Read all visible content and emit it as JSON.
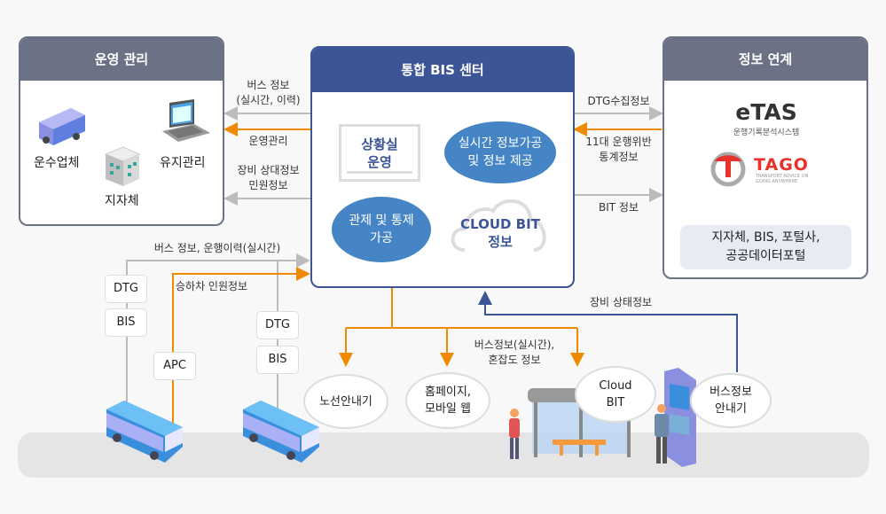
{
  "colors": {
    "panel_header": "#6b7285",
    "center_header": "#3c5597",
    "ellipse_fill": "#4585c5",
    "arrow_gray": "#bbbbbb",
    "arrow_orange": "#f08a00",
    "arrow_navy": "#3c5597",
    "road": "#e5e5e5"
  },
  "operations_panel": {
    "title": "운영 관리",
    "items": [
      {
        "label": "운수업체",
        "icon": "bus-icon"
      },
      {
        "label": "지자체",
        "icon": "building-icon"
      },
      {
        "label": "유지관리",
        "icon": "laptop-icon"
      }
    ]
  },
  "center_panel": {
    "title": "통합 BIS 센터",
    "situation_room": "상황실\n운영",
    "realtime_processing": "실시간 정보가공\n및 정보 제공",
    "control_processing": "관제 및 통제\n가공",
    "cloud_bit": "CLOUD BIT\n정보"
  },
  "partner_panel": {
    "title": "정보 연계",
    "etas_logo": "eTAS",
    "etas_sub": "운행기록분석시스템",
    "tago_logo": "TAGO",
    "tago_sub": "TRANSPORT ADVICE ON\nGOING ANYWHERE",
    "partners": "지자체, BIS, 포털사,\n공공데이터포털"
  },
  "flows": {
    "bus_info_history": "버스 정보\n(실시간, 이력)",
    "operation_mgmt": "운영관리",
    "equipment_complaint": "장비 상대정보\n민원정보",
    "dtg_collect": "DTG수집정보",
    "violation_stats": "11대 운행위반\n통계정보",
    "bit_info": "BIT 정보",
    "bus_history_realtime": "버스 정보, 운행이력(실시간)",
    "boarding_count": "승하차 인원정보",
    "equipment_status": "장비 상태정보",
    "bus_info_congestion": "버스정보(실시간),\n혼잡도 정보"
  },
  "devices": {
    "bus1": [
      "DTG",
      "BIS"
    ],
    "apc": "APC",
    "bus2": [
      "DTG",
      "BIS"
    ]
  },
  "outputs": {
    "route_guide": "노선안내기",
    "homepage": "홈페이지,\n모바일 웹",
    "cloud_bit": "Cloud\nBIT",
    "bus_info_display": "버스정보\n안내기"
  }
}
